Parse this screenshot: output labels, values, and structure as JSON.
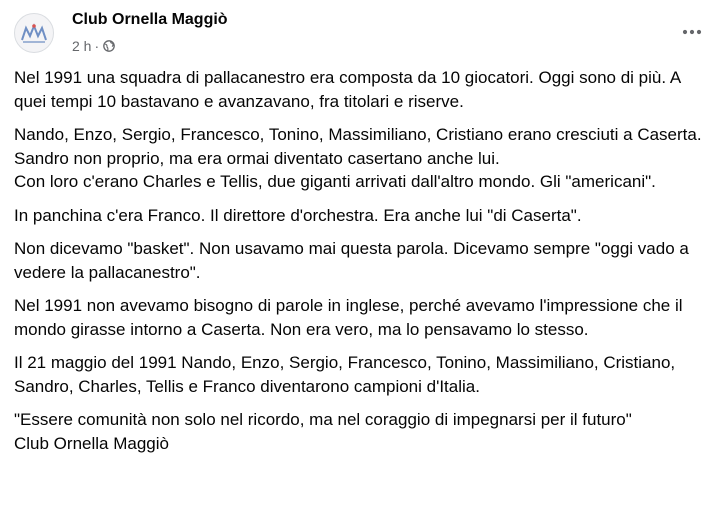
{
  "post": {
    "author": "Club Ornella Maggiò",
    "time": "2 h",
    "separator": "·",
    "privacy_icon": "globe-icon",
    "more_icon": "more-horizontal-icon",
    "paragraphs": [
      "Nel 1991 una squadra di pallacanestro era composta da 10 giocatori. Oggi sono di più. A quei tempi 10 bastavano e avanzavano, fra titolari e riserve.",
      "Nando, Enzo, Sergio, Francesco, Tonino, Massimiliano, Cristiano erano cresciuti a Caserta.\nSandro non proprio, ma era ormai diventato casertano anche lui.\nCon loro c'erano Charles e Tellis, due giganti arrivati dall'altro mondo. Gli \"americani\".",
      "In panchina c'era Franco. Il direttore d'orchestra. Era anche lui \"di Caserta\".",
      "Non dicevamo \"basket\". Non usavamo mai questa parola. Dicevamo sempre \"oggi vado a vedere la pallacanestro\".",
      "Nel 1991 non avevamo bisogno di parole in inglese, perché avevamo l'impressione che il mondo girasse intorno a Caserta. Non era vero, ma lo pensavamo lo stesso.",
      "Il 21 maggio del 1991 Nando, Enzo, Sergio, Francesco, Tonino, Massimiliano, Cristiano, Sandro, Charles, Tellis e Franco diventarono campioni d'Italia.",
      "\"Essere comunità non solo nel ricordo, ma nel coraggio di impegnarsi per il futuro\"\nClub Ornella Maggiò"
    ]
  },
  "colors": {
    "text": "#050505",
    "meta": "#65676b",
    "logo_blue": "#6f8fc4",
    "logo_red": "#d9534f"
  }
}
